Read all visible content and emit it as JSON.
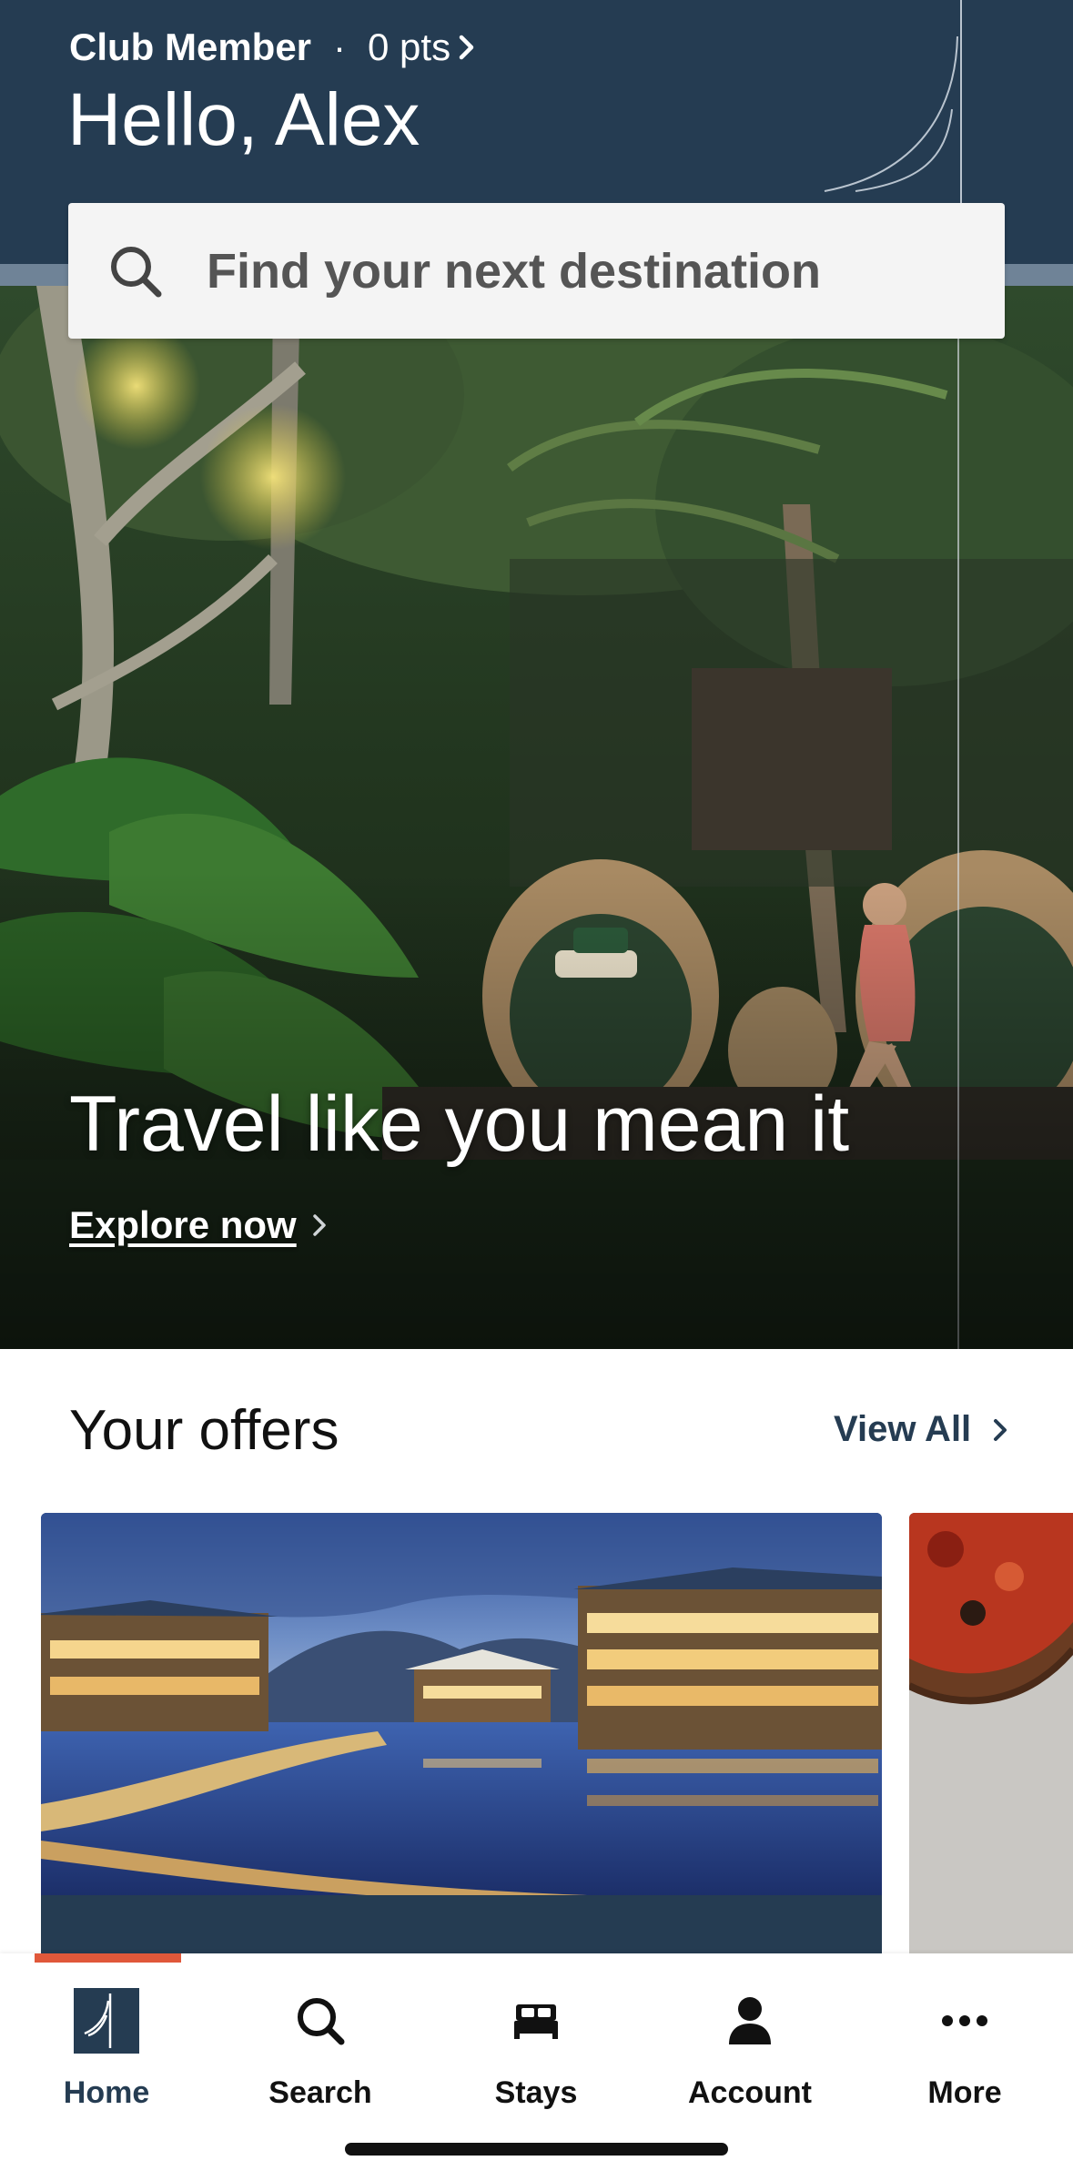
{
  "header": {
    "member_tier": "Club Member",
    "separator": "·",
    "points": "0 pts",
    "greeting": "Hello, Alex"
  },
  "search": {
    "placeholder": "Find your next destination",
    "icon": "search-icon"
  },
  "hero": {
    "title": "Travel like you mean it",
    "link_label": "Explore now"
  },
  "offers": {
    "title": "Your offers",
    "view_all_label": "View All"
  },
  "tabbar": {
    "active": "Home",
    "items": [
      {
        "label": "Home",
        "icon": "four-seasons-logo-icon"
      },
      {
        "label": "Search",
        "icon": "search-icon"
      },
      {
        "label": "Stays",
        "icon": "bed-icon"
      },
      {
        "label": "Account",
        "icon": "person-icon"
      },
      {
        "label": "More",
        "icon": "more-dots-icon"
      }
    ]
  },
  "colors": {
    "header_bg": "#253c52",
    "accent": "#e0583a",
    "link": "#253c52"
  }
}
